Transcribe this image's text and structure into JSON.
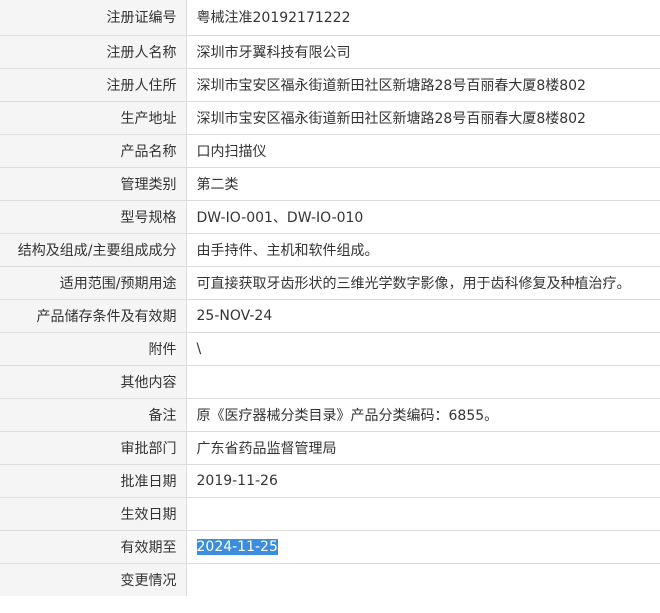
{
  "rows": [
    {
      "label": "注册证编号",
      "value": "粤械注准20192171222"
    },
    {
      "label": "注册人名称",
      "value": "深圳市牙翼科技有限公司"
    },
    {
      "label": "注册人住所",
      "value": "深圳市宝安区福永街道新田社区新塘路28号百丽春大厦8楼802"
    },
    {
      "label": "生产地址",
      "value": "深圳市宝安区福永街道新田社区新塘路28号百丽春大厦8楼802"
    },
    {
      "label": "产品名称",
      "value": "口内扫描仪"
    },
    {
      "label": "管理类别",
      "value": "第二类"
    },
    {
      "label": "型号规格",
      "value": "DW-IO-001、DW-IO-010"
    },
    {
      "label": "结构及组成/主要组成成分",
      "value": "由手持件、主机和软件组成。"
    },
    {
      "label": "适用范围/预期用途",
      "value": "可直接获取牙齿形状的三维光学数字影像，用于齿科修复及种植治疗。"
    },
    {
      "label": "产品储存条件及有效期",
      "value": "25-NOV-24"
    },
    {
      "label": "附件",
      "value": "\\"
    },
    {
      "label": "其他内容",
      "value": ""
    },
    {
      "label": "备注",
      "value": "原《医疗器械分类目录》产品分类编码：6855。"
    },
    {
      "label": "审批部门",
      "value": "广东省药品监督管理局"
    },
    {
      "label": "批准日期",
      "value": "2019-11-26"
    },
    {
      "label": "生效日期",
      "value": ""
    },
    {
      "label": "有效期至",
      "value": "2024-11-25",
      "selected": true
    },
    {
      "label": "变更情况",
      "value": ""
    }
  ],
  "colors": {
    "label_bg": "#f5f5f5",
    "border": "#dcdcdc",
    "text": "#333333",
    "selection_bg": "#3c8dde",
    "selection_text": "#ffffff"
  }
}
